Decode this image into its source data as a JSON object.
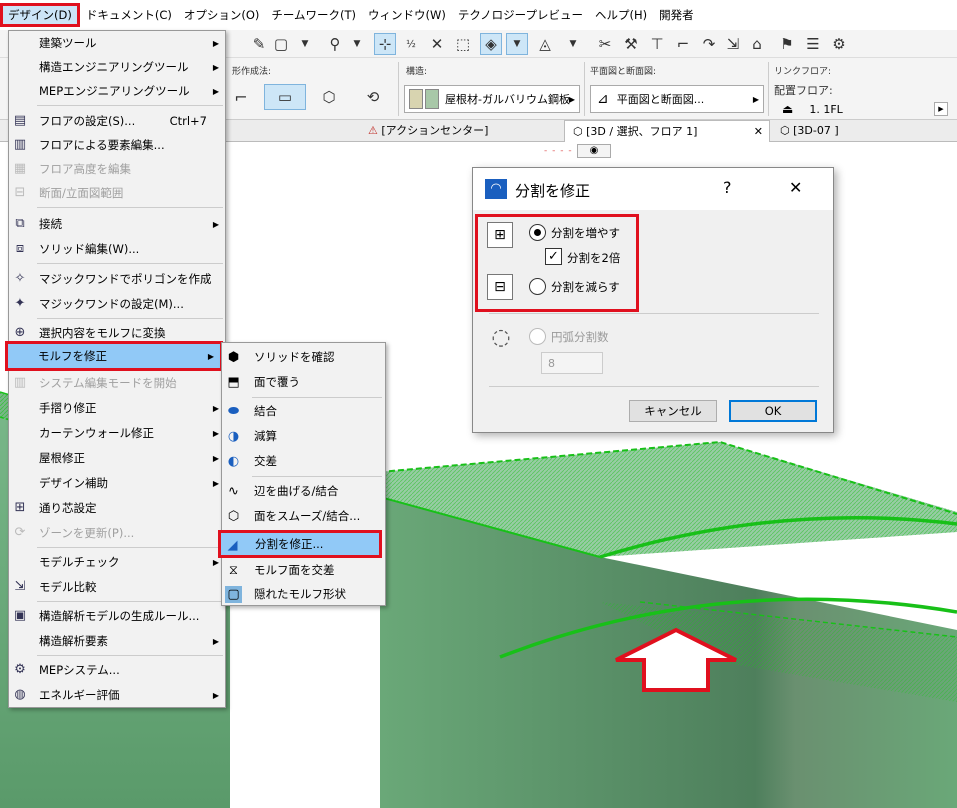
{
  "menubar": [
    "デザイン(D)",
    "ドキュメント(C)",
    "オプション(O)",
    "チームワーク(T)",
    "ウィンドウ(W)",
    "テクノロジープレビュー",
    "ヘルプ(H)",
    "開発者"
  ],
  "infobox": {
    "shape_label": "形作成法:",
    "structure_label": "構造:",
    "structure_value": "屋根材-ガルバリウム鋼板",
    "plan_section_label": "平面図と断面図:",
    "plan_section_value": "平面図と断面図...",
    "link_floor_label": "リンクフロア:",
    "home_floor_label": "配置フロア:",
    "home_floor_value": "1. 1FL"
  },
  "tabs": {
    "action_center": "[アクションセンター]",
    "view3d": "[3D / 選択、フロア 1]",
    "view3d07": "[3D-07 ]"
  },
  "nav_indicator": "- - - -",
  "menu": {
    "items": [
      {
        "label": "建築ツール",
        "arrow": true
      },
      {
        "label": "構造エンジニアリングツール",
        "arrow": true
      },
      {
        "label": "MEPエンジニアリングツール",
        "arrow": true
      },
      {
        "label": "フロアの設定(S)...",
        "shortcut": "Ctrl+7"
      },
      {
        "label": "フロアによる要素編集..."
      },
      {
        "label": "フロア高度を編集"
      },
      {
        "label": "断面/立面図範囲"
      },
      {
        "label": "接続",
        "arrow": true
      },
      {
        "label": "ソリッド編集(W)..."
      },
      {
        "label": "マジックワンドでポリゴンを作成"
      },
      {
        "label": "マジックワンドの設定(M)..."
      },
      {
        "label": "選択内容をモルフに変換"
      },
      {
        "label": "モルフを修正",
        "arrow": true
      },
      {
        "label": "システム編集モードを開始"
      },
      {
        "label": "手摺り修正",
        "arrow": true
      },
      {
        "label": "カーテンウォール修正",
        "arrow": true
      },
      {
        "label": "屋根修正",
        "arrow": true
      },
      {
        "label": "デザイン補助",
        "arrow": true
      },
      {
        "label": "通り芯設定"
      },
      {
        "label": "ゾーンを更新(P)..."
      },
      {
        "label": "モデルチェック",
        "arrow": true
      },
      {
        "label": "モデル比較"
      },
      {
        "label": "構造解析モデルの生成ルール..."
      },
      {
        "label": "構造解析要素",
        "arrow": true
      },
      {
        "label": "MEPシステム..."
      },
      {
        "label": "エネルギー評価",
        "arrow": true
      }
    ]
  },
  "submenu": {
    "items": [
      {
        "label": "ソリッドを確認"
      },
      {
        "label": "面で覆う"
      },
      {
        "label": "結合"
      },
      {
        "label": "減算"
      },
      {
        "label": "交差"
      },
      {
        "label": "辺を曲げる/結合"
      },
      {
        "label": "面をスムーズ/結合..."
      },
      {
        "label": "分割を修正..."
      },
      {
        "label": "モルフ面を交差"
      },
      {
        "label": "隠れたモルフ形状"
      }
    ]
  },
  "dialog": {
    "title": "分割を修正",
    "help": "?",
    "close": "✕",
    "increase": "分割を増やす",
    "double": "分割を2倍",
    "decrease": "分割を減らす",
    "arc": "円弧分割数",
    "arc_value": "8",
    "cancel": "キャンセル",
    "ok": "OK"
  },
  "colors": {
    "accent": "#e0101e",
    "highlight": "#91c9f7",
    "morph": "#1fc31f"
  }
}
